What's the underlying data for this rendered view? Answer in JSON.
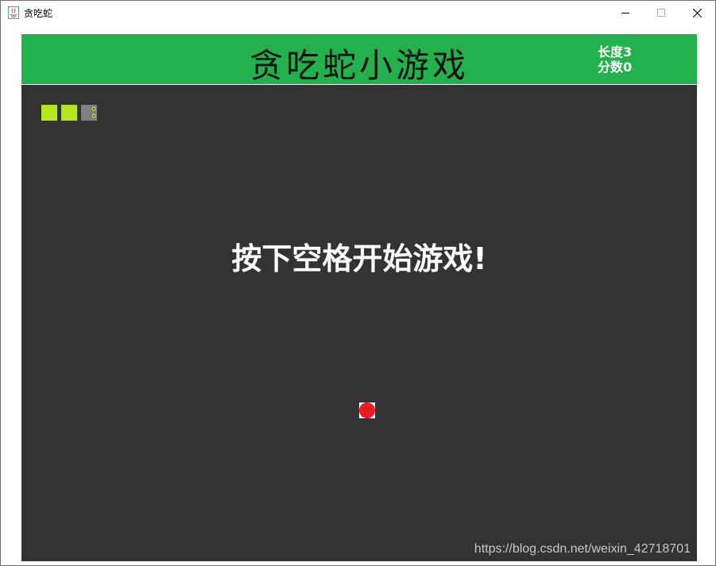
{
  "window": {
    "title": "贪吃蛇",
    "icons": {
      "app": "java-app-icon",
      "minimize": "minimize-icon",
      "maximize": "maximize-icon",
      "close": "close-icon"
    }
  },
  "header": {
    "title": "贪吃蛇小游戏",
    "length_label": "长度",
    "length_value": "3",
    "score_label": "分数",
    "score_value": "0"
  },
  "board": {
    "message": "按下空格开始游戏!",
    "snake_length": 3,
    "snake_direction": "right"
  },
  "watermark": "https://blog.csdn.net/weixin_42718701",
  "colors": {
    "header_bg": "#23b14d",
    "board_bg": "#333333",
    "snake_body": "#b5e61d",
    "snake_head": "#808080",
    "food": "#ed1c24"
  }
}
